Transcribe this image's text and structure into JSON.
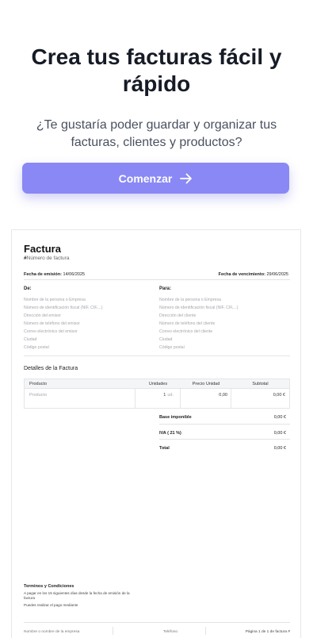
{
  "hero": {
    "title": "Crea tus facturas fácil y rápido",
    "subtitle": "¿Te gustaría poder guardar y organizar tus facturas, clientes y productos?",
    "cta_label": "Comenzar",
    "accent": "#8a88f5"
  },
  "invoice": {
    "title": "Factura",
    "number_prefix": "#",
    "number_placeholder": "Número de factura",
    "issue_label": "Fecha de emisión:",
    "issue_date": "14/06/2025",
    "due_label": "Fecha de vencimiento:",
    "due_date": "29/06/2025",
    "from": {
      "heading": "De:",
      "fields": [
        "Nombre de la persona o Empresa",
        "Número de identificación fiscal (NIF, CIF,...)",
        "Dirección del emisor",
        "Número de teléfono del emisor",
        "Correo electrónico del emisor",
        "Ciudad",
        "Código postal"
      ]
    },
    "to": {
      "heading": "Para:",
      "fields": [
        "Nombre de la persona o Empresa",
        "Número de identificación fiscal (NIF, CIF,...)",
        "Dirección del cliente",
        "Número de teléfono del cliente",
        "Correo electrónico del cliente",
        "Ciudad",
        "Código postal"
      ]
    },
    "details_title": "Detalles de la Factura",
    "table": {
      "headers": [
        "Producto",
        "Unidades",
        "Precio Unidad",
        "Subtotal"
      ],
      "row": {
        "product": "Producto",
        "units": "1",
        "unit_label": "ud.",
        "price": "0,00",
        "subtotal": "0,00 €"
      }
    },
    "totals": {
      "base_label": "Base imponible",
      "base_value": "0,00 €",
      "iva_label": "IVA ( 21 %)",
      "iva_value": "0,00 €",
      "total_label": "Total",
      "total_value": "0,00 €"
    },
    "terms": {
      "heading": "Terminos y Condiciones",
      "text": "A pagar en los 15 siguientes días desde la fecha de emisión de la factura",
      "payment": "Puedes realizar el pago mediante"
    },
    "footer": {
      "company": "Nombre o nombre de la empresa",
      "phone": "Teléfono",
      "page": "Página 1 de 1 de factura #"
    }
  }
}
